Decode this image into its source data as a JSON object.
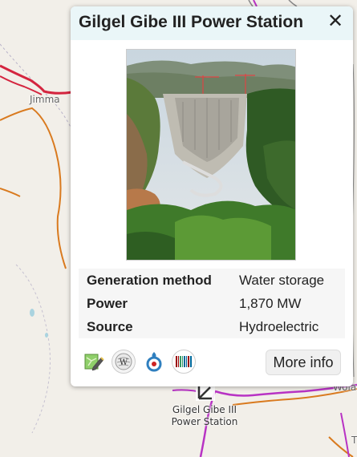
{
  "map": {
    "labels": {
      "jimma": "Jimma",
      "wola": "Wola",
      "t": "T"
    },
    "marker": {
      "label_line1": "Gilgel Gibe III",
      "label_line2": "Power Station"
    },
    "colors": {
      "background": "#f2efe9",
      "main_road": "#d97a1f",
      "power_line": "#b833c4",
      "railway_red": "#d4253f",
      "border": "#a3a3a3"
    }
  },
  "popup": {
    "title": "Gilgel Gibe III Power Station",
    "close_label": "✕",
    "photo_description_icon": "dam-photo",
    "table": [
      {
        "key": "Generation method",
        "value": "Water storage"
      },
      {
        "key": "Power",
        "value": "1,870 MW"
      },
      {
        "key": "Source",
        "value": "Hydroelectric"
      }
    ],
    "icons": [
      "map-pencil-icon",
      "wikipedia-icon",
      "wikimedia-commons-icon",
      "wikidata-icon"
    ],
    "more_info_label": "More info",
    "header_bg": "#eaf6f8"
  }
}
